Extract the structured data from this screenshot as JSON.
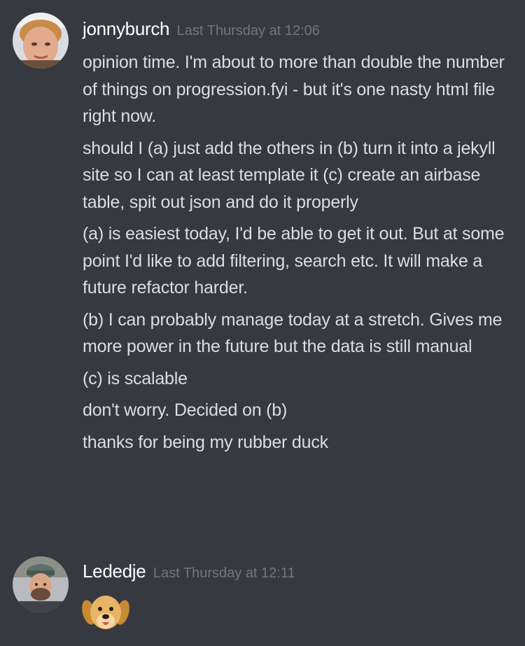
{
  "chat": {
    "groups": [
      {
        "username": "jonnyburch",
        "timestamp": "Last Thursday at 12:06",
        "messages": [
          "opinion time. I'm about to more than double the number of things on progression.fyi - but it's one nasty html file right now.",
          "should I (a) just add the others in (b) turn it into a jekyll site so I can at least template it (c) create an airbase table, spit out json and do it properly",
          "(a) is easiest today, I'd be able to get it out. But at some point I'd like to add filtering, search etc. It will make a future refactor harder.",
          "(b) I can probably manage today at a stretch. Gives me more power in the future but the data is still manual",
          "(c) is scalable",
          "don't worry. Decided on (b)",
          "thanks for being my rubber duck"
        ]
      },
      {
        "username": "Lededje",
        "timestamp": "Last Thursday at 12:11",
        "emoji": "dog-face-emoji"
      }
    ]
  },
  "colors": {
    "background": "#36393f",
    "username": "#ffffff",
    "timestamp": "#72767d",
    "message_text": "#dcddde"
  }
}
